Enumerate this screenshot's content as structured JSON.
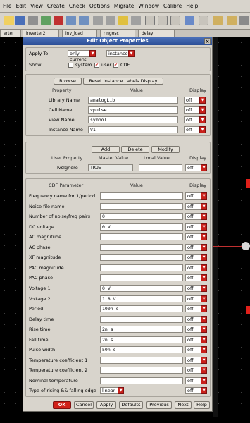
{
  "menubar": {
    "items": [
      "File",
      "Edit",
      "View",
      "Create",
      "Check",
      "Options",
      "Migrate",
      "Window",
      "Calibre",
      "Help"
    ]
  },
  "tabs": [
    "erter",
    "inverter2",
    "inv_load",
    "ringosc",
    "delay"
  ],
  "dialog": {
    "title": "Edit Object Properties",
    "close_label": "×",
    "apply_to": {
      "label": "Apply To",
      "scope": "only current",
      "target": "instance"
    },
    "show": {
      "label": "Show",
      "options": [
        {
          "label": "system",
          "checked": false
        },
        {
          "label": "user",
          "checked": true
        },
        {
          "label": "CDF",
          "checked": true
        }
      ]
    },
    "attr": {
      "browse_label": "Browse",
      "reset_label": "Reset Instance Labels Display",
      "col_property": "Property",
      "col_value": "Value",
      "col_display": "Display",
      "rows": [
        {
          "label": "Library Name",
          "value": "analogLib",
          "display": "off"
        },
        {
          "label": "Cell Name",
          "value": "vpulse",
          "display": "off"
        },
        {
          "label": "View Name",
          "value": "symbol",
          "display": "off"
        },
        {
          "label": "Instance Name",
          "value": "V1",
          "display": "off"
        }
      ]
    },
    "user": {
      "add_label": "Add",
      "delete_label": "Delete",
      "modify_label": "Modify",
      "col_property": "User Property",
      "col_master": "Master Value",
      "col_local": "Local Value",
      "col_display": "Display",
      "rows": [
        {
          "label": "lvsIgnore",
          "master": "TRUE",
          "local": "",
          "display": "off"
        }
      ]
    },
    "cdf": {
      "col_param": "CDF Parameter",
      "col_value": "Value",
      "col_display": "Display",
      "rows": [
        {
          "label": "Frequency name for 1/period",
          "value": "",
          "display": "off"
        },
        {
          "label": "Noise file name",
          "value": "",
          "display": "off"
        },
        {
          "label": "Number of noise/freq pairs",
          "value": "0",
          "display": "off"
        },
        {
          "label": "DC voltage",
          "value": "0 V",
          "display": "off"
        },
        {
          "label": "AC magnitude",
          "value": "",
          "display": "off"
        },
        {
          "label": "AC phase",
          "value": "",
          "display": "off"
        },
        {
          "label": "XF magnitude",
          "value": "",
          "display": "off"
        },
        {
          "label": "PAC magnitude",
          "value": "",
          "display": "off"
        },
        {
          "label": "PAC phase",
          "value": "",
          "display": "off"
        },
        {
          "label": "Voltage 1",
          "value": "0 V",
          "display": "off"
        },
        {
          "label": "Voltage 2",
          "value": "1.8 V",
          "display": "off"
        },
        {
          "label": "Period",
          "value": "100n s",
          "display": "off"
        },
        {
          "label": "Delay time",
          "value": "",
          "display": "off"
        },
        {
          "label": "Rise time",
          "value": "2n s",
          "display": "off"
        },
        {
          "label": "Fall time",
          "value": "2n s",
          "display": "off"
        },
        {
          "label": "Pulse width",
          "value": "50n s",
          "display": "off"
        },
        {
          "label": "Temperature coefficient 1",
          "value": "",
          "display": "off"
        },
        {
          "label": "Temperature coefficient 2",
          "value": "",
          "display": "off"
        },
        {
          "label": "Nominal temperature",
          "value": "",
          "display": "off"
        },
        {
          "label": "Type of rising && falling edge",
          "value": "linear",
          "display": "off"
        }
      ]
    },
    "buttons": {
      "ok": "OK",
      "cancel": "Cancel",
      "apply": "Apply",
      "defaults": "Defaults",
      "previous": "Previous",
      "next": "Next",
      "help": "Help"
    }
  },
  "colors": {
    "title_bar": "#2c4e96",
    "dropdown_arrow": "#c8201a",
    "canvas": "#000000",
    "marker": "#e0201a"
  }
}
